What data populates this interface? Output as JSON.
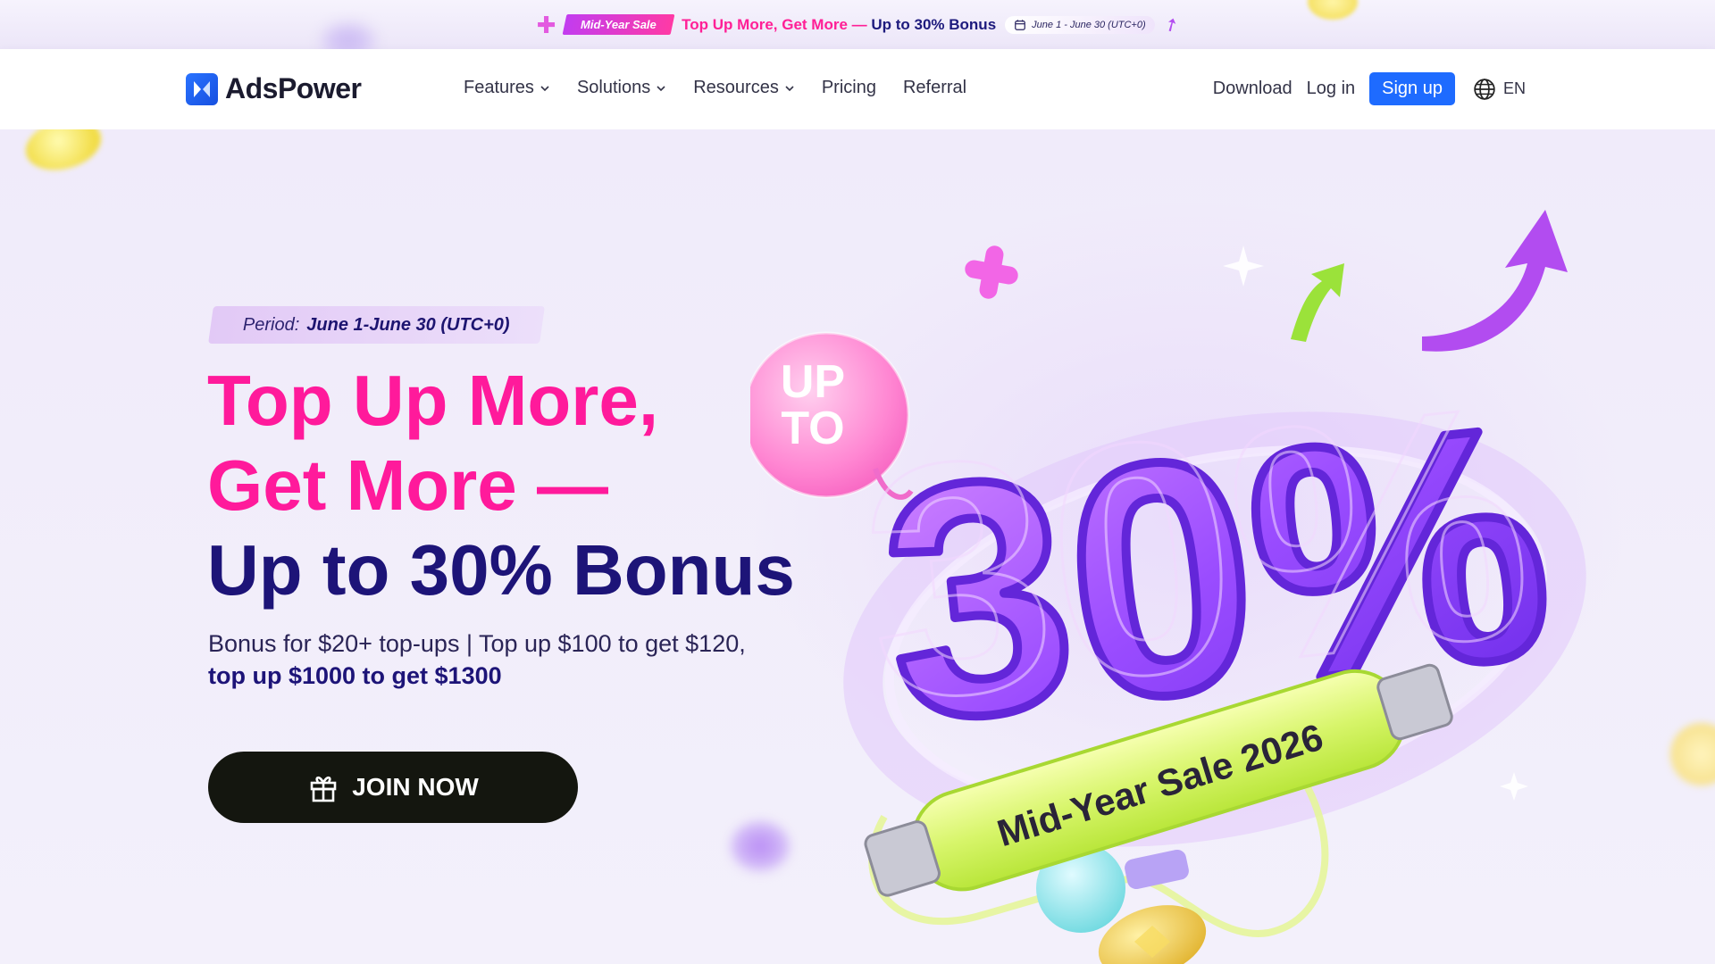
{
  "promo": {
    "tag": "Mid-Year Sale",
    "headline_pink": "Top Up More, Get More —",
    "headline_dark": "Up to 30% Bonus",
    "date": "June 1 - June 30 (UTC+0)"
  },
  "nav": {
    "logo": "AdsPower",
    "items": [
      {
        "label": "Features",
        "has_menu": true
      },
      {
        "label": "Solutions",
        "has_menu": true
      },
      {
        "label": "Resources",
        "has_menu": true
      },
      {
        "label": "Pricing",
        "has_menu": false
      },
      {
        "label": "Referral",
        "has_menu": false
      }
    ],
    "download": "Download",
    "login": "Log in",
    "signup": "Sign up",
    "lang": "EN"
  },
  "hero": {
    "period_label": "Period:",
    "period_value": "June 1-June 30 (UTC+0)",
    "headline": [
      "Top Up More,",
      "Get More —",
      "Up to 30% Bonus"
    ],
    "sub_line1": "Bonus for $20+ top-ups | Top up $100 to get $120,",
    "sub_line2": "top up $1000 to get $1300",
    "cta": "JOIN NOW"
  },
  "art": {
    "bubble_line1": "UP",
    "bubble_line2": "TO",
    "big_number": "30%",
    "tube_text": "Mid-Year Sale 2026"
  },
  "colors": {
    "accent_pink": "#ff1a9b",
    "brand_blue": "#1e6bff",
    "deep_navy": "#1d1478",
    "cta_bg": "#14160f"
  }
}
